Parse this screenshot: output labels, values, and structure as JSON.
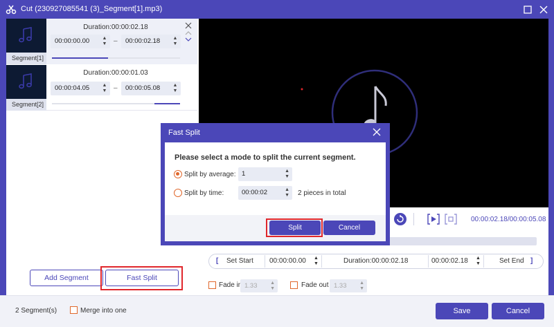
{
  "window": {
    "title": "Cut (230927085541 (3)_Segment[1].mp3)",
    "brand_color": "#4b47b8",
    "accent_color": "#e0672b",
    "highlight_color": "#e0262b"
  },
  "segments": [
    {
      "label": "Segment[1]",
      "duration": "Duration:00:00:02.18",
      "start": "00:00:00.00",
      "end": "00:00:02.18",
      "range_start": 0.0,
      "range_end": 0.44
    },
    {
      "label": "Segment[2]",
      "duration": "Duration:00:00:01.03",
      "start": "00:00:04.05",
      "end": "00:00:05.08",
      "range_start": 0.8,
      "range_end": 1.0
    }
  ],
  "left_actions": {
    "add_segment": "Add Segment",
    "fast_split": "Fast Split"
  },
  "player": {
    "time_readout": "00:00:02.18/00:00:05.08"
  },
  "cut_bar": {
    "set_start": "Set Start",
    "start_value": "00:00:00.00",
    "duration": "Duration:00:00:02.18",
    "end_value": "00:00:02.18",
    "set_end": "Set End",
    "bracket_left": "[",
    "bracket_right": "]"
  },
  "fade": {
    "fade_in_label": "Fade in",
    "fade_in_value": "1.33",
    "fade_out_label": "Fade out",
    "fade_out_value": "1.33"
  },
  "footer": {
    "segment_count": "2 Segment(s)",
    "merge_label": "Merge into one",
    "save": "Save",
    "cancel": "Cancel"
  },
  "dialog": {
    "title": "Fast Split",
    "prompt": "Please select a mode to split the current segment.",
    "by_average_label": "Split by average:",
    "by_average_value": "1",
    "by_time_label": "Split by time:",
    "by_time_value": "00:00:02",
    "pieces_text": "2 pieces in total",
    "split": "Split",
    "cancel": "Cancel"
  }
}
